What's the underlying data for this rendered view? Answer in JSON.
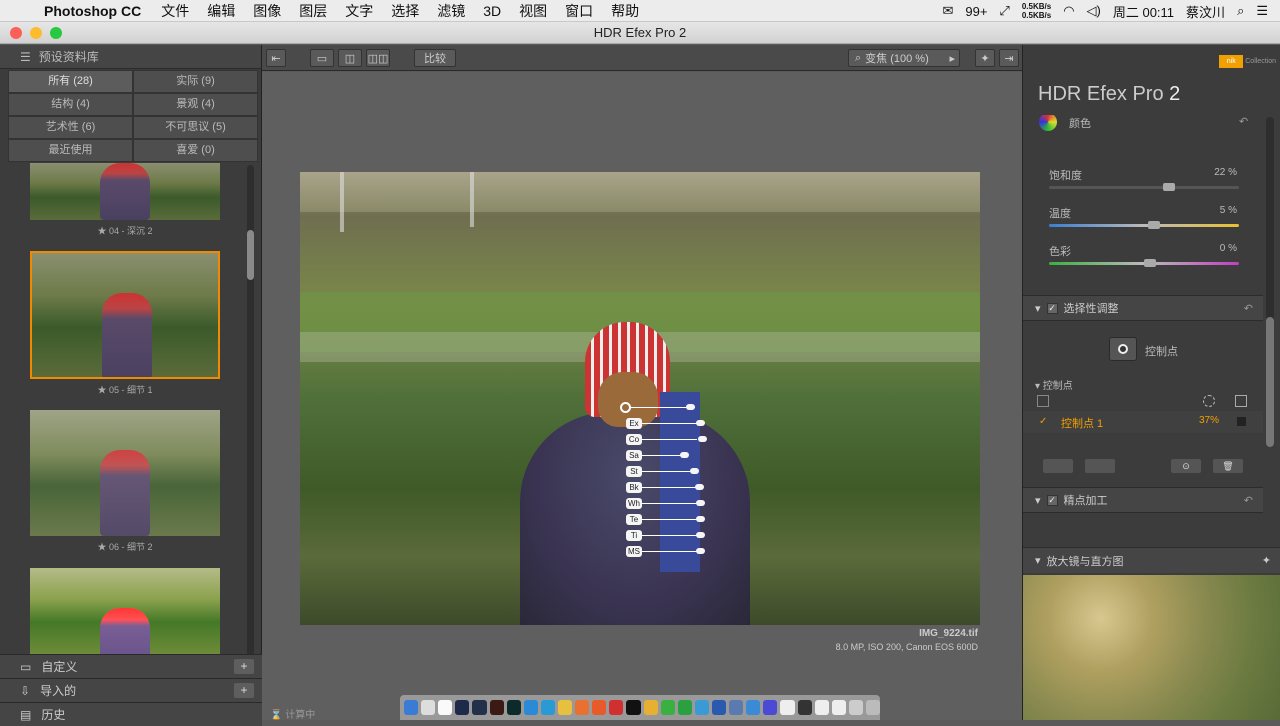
{
  "menubar": {
    "app_name": "Photoshop CC",
    "menus": [
      "文件",
      "编辑",
      "图像",
      "图层",
      "文字",
      "选择",
      "滤镜",
      "3D",
      "视图",
      "窗口",
      "帮助"
    ],
    "net_up": "0.5KB/s",
    "net_down": "0.5KB/s",
    "badge": "99+",
    "clock": "周二 00:11",
    "user": "蔡汶川"
  },
  "window": {
    "title": "HDR Efex Pro 2"
  },
  "left_panel": {
    "header": "预设资料库",
    "categories": [
      {
        "label": "所有 (28)"
      },
      {
        "label": "实际 (9)"
      },
      {
        "label": "结构 (4)"
      },
      {
        "label": "景观 (4)"
      },
      {
        "label": "艺术性 (6)"
      },
      {
        "label": "不可思议 (5)"
      },
      {
        "label": "最近使用"
      },
      {
        "label": "喜爱 (0)"
      }
    ],
    "thumbnails": [
      {
        "caption": "★ 04 - 深沉 2"
      },
      {
        "caption": "★ 05 - 细节 1"
      },
      {
        "caption": "★ 06 - 细节 2"
      },
      {
        "caption": ""
      }
    ],
    "footer": [
      {
        "label": "自定义"
      },
      {
        "label": "导入的"
      },
      {
        "label": "历史"
      }
    ]
  },
  "toolbar": {
    "compare_label": "比较",
    "zoom_label": "变焦 (100 %)"
  },
  "image": {
    "filename": "IMG_9224.tif",
    "meta": "8.0 MP, ISO 200, Canon EOS 600D",
    "control_point_tags": [
      "Ex",
      "Co",
      "Sa",
      "St",
      "Bk",
      "Wh",
      "Te",
      "Ti",
      "MS"
    ]
  },
  "right_panel": {
    "app_title": "HDR Efex Pro",
    "app_version": "2",
    "collection_label": "Collection",
    "color_section": "颜色",
    "sliders": [
      {
        "label": "饱和度",
        "value": "22 %",
        "pos": 0.6
      },
      {
        "label": "温度",
        "value": "5 %",
        "pos": 0.52
      },
      {
        "label": "色彩",
        "value": "0 %",
        "pos": 0.5
      }
    ],
    "selective_title": "选择性调整",
    "control_point_button": "控制点",
    "control_points_header": "控制点",
    "control_point_item": "控制点 1",
    "control_point_value": "37%",
    "finishing_title": "精点加工",
    "loupe_title": "放大镜与直方图"
  },
  "status": {
    "computing": "计算中"
  },
  "colors": {
    "accent": "#f08a00",
    "point_text": "#f0a000"
  }
}
